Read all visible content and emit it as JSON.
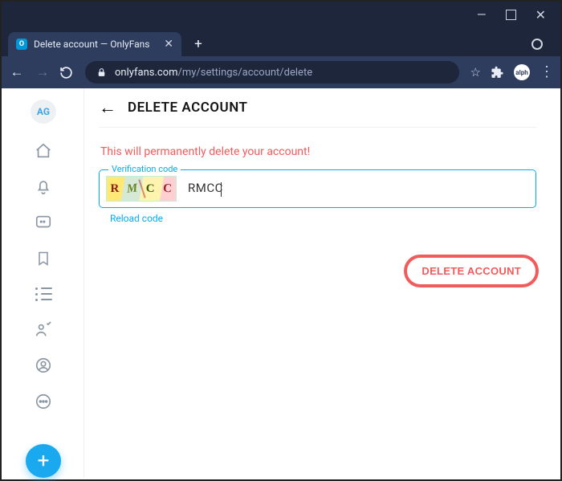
{
  "window": {
    "tab_title": "Delete account — OnlyFans",
    "favicon_letter": "O"
  },
  "toolbar": {
    "url_host": "onlyfans.com",
    "url_path": "/my/settings/account/delete",
    "profile_badge": "alph"
  },
  "sidebar": {
    "avatar_initials": "AG"
  },
  "page": {
    "heading": "DELETE ACCOUNT",
    "warning": "This will permanently delete your account!",
    "field_label": "Verification code",
    "captcha_chars": [
      "R",
      "M",
      "C",
      "C"
    ],
    "input_value": "RMCC",
    "reload_label": "Reload code",
    "submit_label": "DELETE ACCOUNT"
  }
}
